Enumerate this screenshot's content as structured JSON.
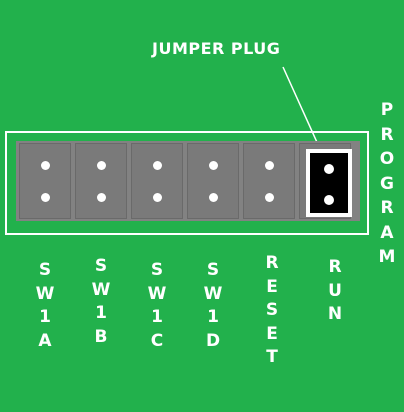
{
  "diagram": {
    "callout_label": "JUMPER PLUG",
    "side_label": "PROGRAM",
    "positions": [
      {
        "label": "SW1A"
      },
      {
        "label": "SW1B"
      },
      {
        "label": "SW1C"
      },
      {
        "label": "SW1D"
      },
      {
        "label": "RESET"
      },
      {
        "label": "RUN"
      }
    ],
    "jumper_installed_on": "RUN",
    "colors": {
      "board": "#22b14c",
      "header": "#828282",
      "pin": "#ffffff",
      "jumper_plug": "#000000",
      "text": "#ffffff"
    }
  }
}
